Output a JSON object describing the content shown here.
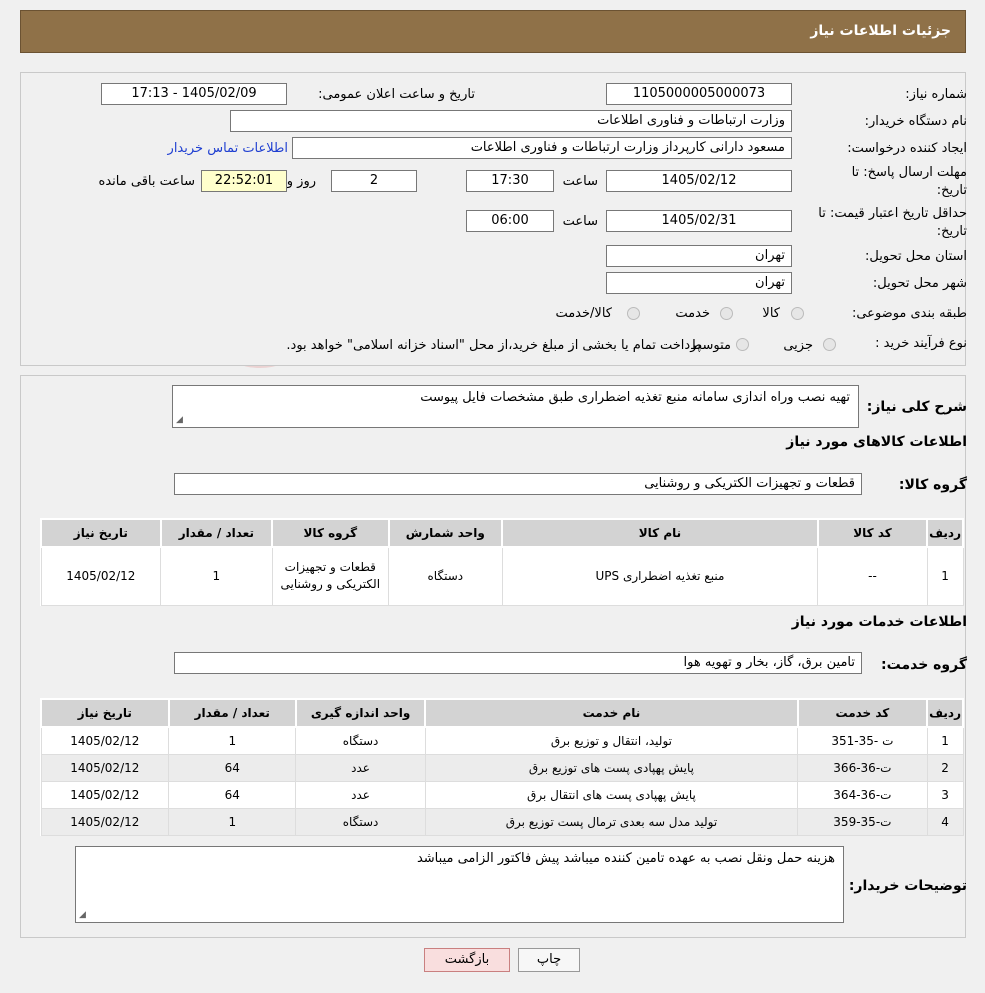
{
  "header": {
    "title": "جزئیات اطلاعات نیاز"
  },
  "form": {
    "need_number_label": "شماره نیاز:",
    "need_number": "1105000005000073",
    "announce_label": "تاریخ و ساعت اعلان عمومی:",
    "announce_value": "1405/02/09 - 17:13",
    "buyer_org_label": "نام دستگاه خریدار:",
    "buyer_org": "وزارت ارتباطات و فناوری اطلاعات",
    "creator_label": "ایجاد کننده درخواست:",
    "creator": "مسعود دارانی کارپرداز وزارت ارتباطات و فناوری اطلاعات",
    "contact_link": "اطلاعات تماس خریدار",
    "deadline_label": "مهلت ارسال پاسخ: تا تاریخ:",
    "deadline_date": "1405/02/12",
    "hour_label": "ساعت",
    "deadline_time": "17:30",
    "days_value": "2",
    "days_label": "روز و",
    "remaining_time": "22:52:01",
    "remaining_label": "ساعت باقی مانده",
    "validity_label": "حداقل تاریخ اعتبار قیمت: تا تاریخ:",
    "validity_date": "1405/02/31",
    "validity_time": "06:00",
    "province_label": "استان محل تحویل:",
    "province": "تهران",
    "city_label": "شهر محل تحویل:",
    "city": "تهران",
    "category_label": "طبقه بندی موضوعی:",
    "category_options": [
      "کالا",
      "خدمت",
      "کالا/خدمت"
    ],
    "process_label": "نوع فرآیند خرید :",
    "process_options": [
      "جزیی",
      "متوسط"
    ],
    "process_note": "پرداخت تمام یا بخشی از مبلغ خرید،از محل \"اسناد خزانه اسلامی\" خواهد بود."
  },
  "description": {
    "label": "شرح کلی نیاز:",
    "value": "تهیه نصب وراه اندازی سامانه منبع تغذیه اضطراری طبق مشخصات فایل پیوست"
  },
  "goods": {
    "section_title": "اطلاعات کالاهای مورد نیاز",
    "group_label": "گروه کالا:",
    "group_value": "قطعات و تجهیزات الکتریکی و روشنایی",
    "columns": [
      "ردیف",
      "کد کالا",
      "نام کالا",
      "واحد شمارش",
      "گروه کالا",
      "تعداد / مقدار",
      "تاریخ نیاز"
    ],
    "rows": [
      [
        "1",
        "--",
        "منبع تغذیه اضطراری UPS",
        "دستگاه",
        "قطعات و تجهیزات الکتریکی و روشنایی",
        "1",
        "1405/02/12"
      ]
    ]
  },
  "services": {
    "section_title": "اطلاعات خدمات مورد نیاز",
    "group_label": "گروه خدمت:",
    "group_value": "تامین برق، گاز، بخار و تهویه هوا",
    "columns": [
      "ردیف",
      "کد خدمت",
      "نام خدمت",
      "واحد اندازه گیری",
      "تعداد / مقدار",
      "تاریخ نیاز"
    ],
    "rows": [
      [
        "1",
        "ت -35-351",
        "تولید، انتقال و توزیع برق",
        "دستگاه",
        "1",
        "1405/02/12"
      ],
      [
        "2",
        "ت-36-366",
        "پایش پهپادی پست های توزیع برق",
        "عدد",
        "64",
        "1405/02/12"
      ],
      [
        "3",
        "ت-36-364",
        "پایش پهپادی پست های انتقال برق",
        "عدد",
        "64",
        "1405/02/12"
      ],
      [
        "4",
        "ت-35-359",
        "تولید مدل سه بعدی ترمال پست توزیع برق",
        "دستگاه",
        "1",
        "1405/02/12"
      ]
    ]
  },
  "buyer_notes": {
    "label": "توضیحات خریدار:",
    "value": "هزینه حمل ونقل نصب به عهده تامین کننده میباشد پیش فاکتور الزامی میباشد"
  },
  "buttons": {
    "print": "چاپ",
    "back": "بازگشت"
  },
  "watermark": {
    "text": "AriaTender.neT"
  },
  "colors": {
    "header_bg": "#8f7148",
    "link": "#1f3fd1",
    "back_button_bg": "#f9dede"
  }
}
